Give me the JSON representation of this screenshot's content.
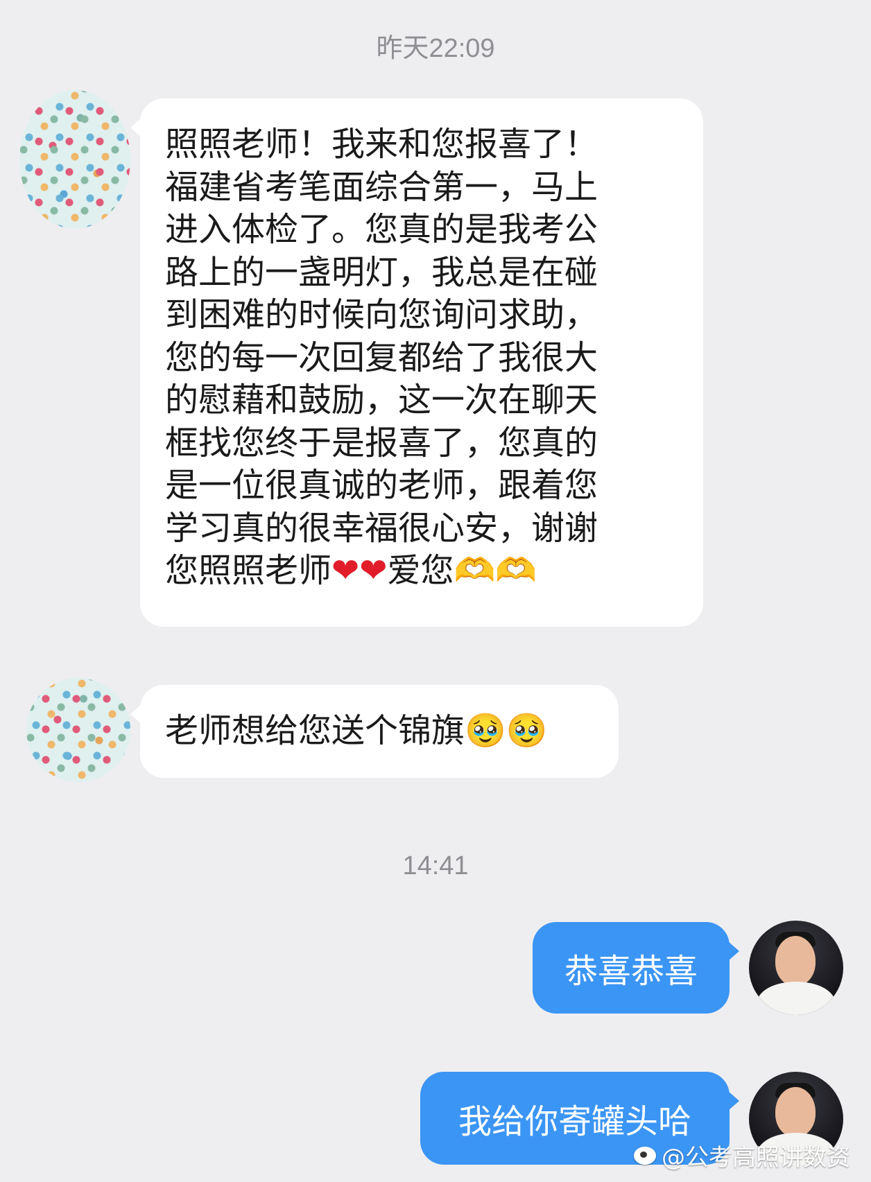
{
  "timestamps": [
    "昨天22:09",
    "14:41"
  ],
  "messages": [
    {
      "direction": "incoming",
      "lines": [
        "照照老师！我来和您报喜了！",
        "福建省考笔面综合第一，马上",
        "进入体检了。您真的是我考公",
        "路上的一盏明灯，我总是在碰",
        "到困难的时候向您询问求助，",
        "您的每一次回复都给了我很大",
        "的慰藉和鼓励，这一次在聊天",
        "框找您终于是报喜了，您真的",
        "是一位很真诚的老师，跟着您",
        "学习真的很幸福很心安，谢谢"
      ],
      "last_line": {
        "text_a": "您照照老师",
        "emoji_hearts": "❤❤",
        "text_b": "爱您",
        "emoji_hands": "🫶🫶"
      }
    },
    {
      "direction": "incoming",
      "text": "老师想给您送个锦旗",
      "emoji": "🥹🥹"
    },
    {
      "direction": "outgoing",
      "text": "恭喜恭喜"
    },
    {
      "direction": "outgoing",
      "text": "我给你寄罐头哈"
    }
  ],
  "watermark": {
    "icon": "weibo-icon",
    "text": "@公考高照讲数资"
  },
  "colors": {
    "background": "#eeeef0",
    "incoming_bubble": "#ffffff",
    "outgoing_bubble": "#3b95f4",
    "timestamp": "#8e8e93"
  }
}
